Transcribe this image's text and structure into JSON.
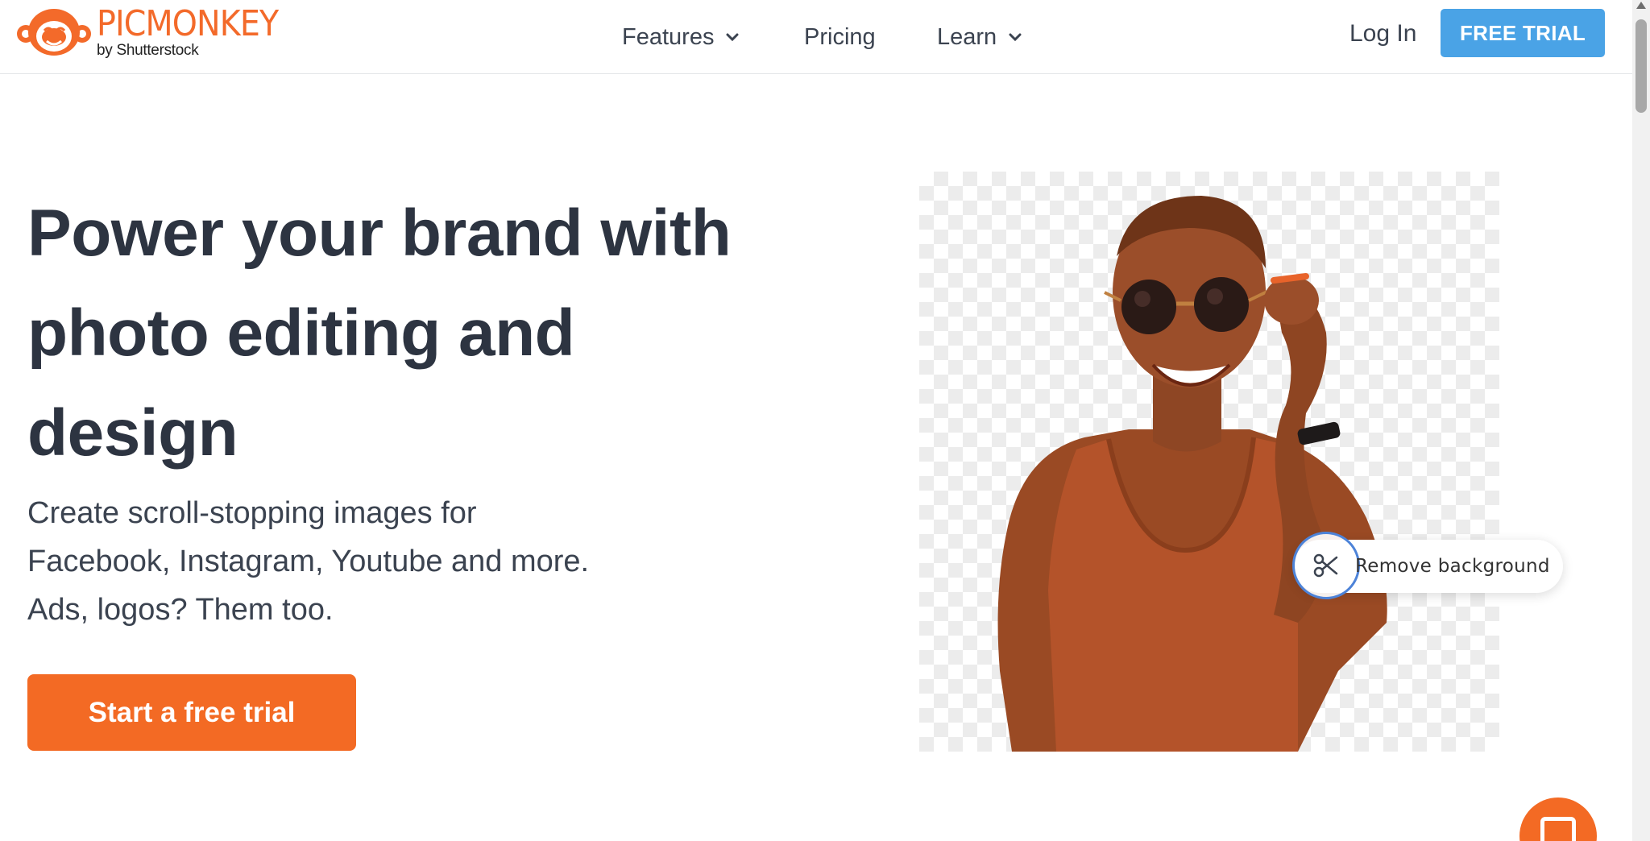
{
  "brand": {
    "name": "PICMONKEY",
    "sub": "by Shutterstock",
    "color": "#f36a2a"
  },
  "nav": {
    "features": "Features",
    "pricing": "Pricing",
    "learn": "Learn",
    "login": "Log In",
    "free_trial": "FREE TRIAL"
  },
  "hero": {
    "headline": "Power your brand with photo editing and design",
    "subtext_lines": [
      "Create scroll-stopping images for",
      "Facebook, Instagram, Youtube and more.",
      "Ads, logos? Them too."
    ],
    "cta": "Start a free trial",
    "badge_label": "Remove background"
  },
  "colors": {
    "accent_orange": "#f36a24",
    "trial_blue": "#4aa3e6",
    "ring_blue": "#4d83d8",
    "text_dark": "#2d3441"
  },
  "icons": [
    "monkey-logo-icon",
    "chevron-down-icon",
    "scissors-icon",
    "chat-icon"
  ]
}
